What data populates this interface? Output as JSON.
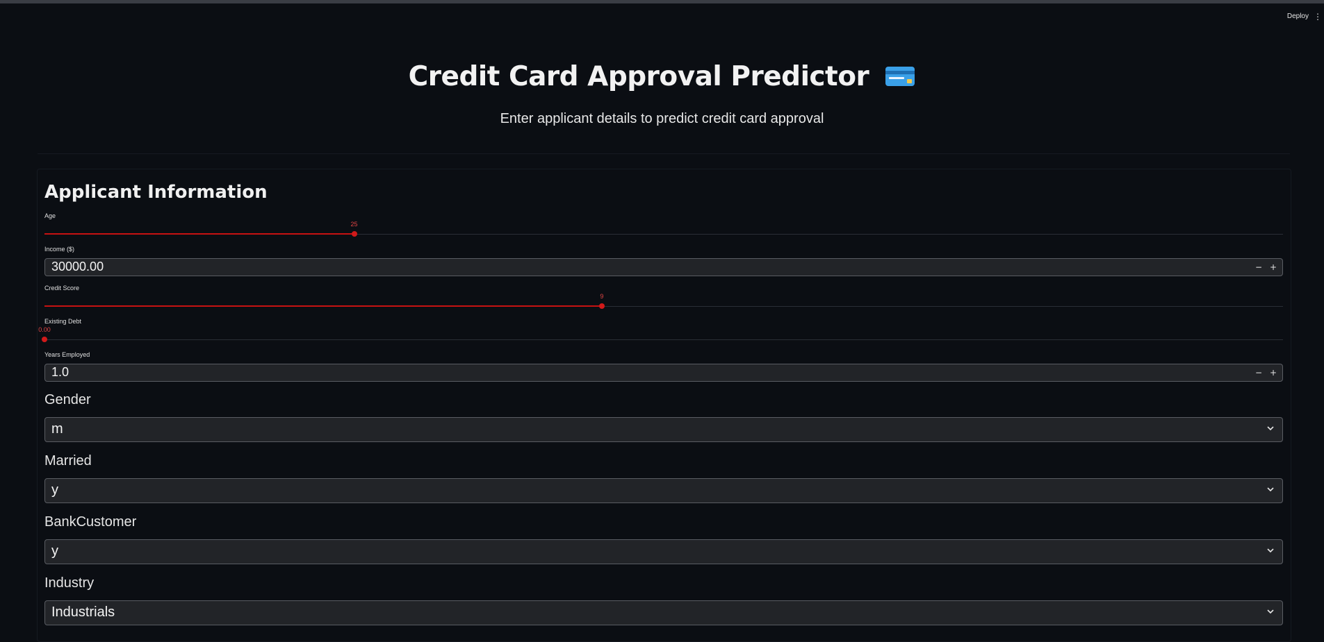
{
  "header": {
    "deploy_label": "Deploy",
    "menu_glyph": "⋮"
  },
  "page": {
    "title": "Credit Card Approval Predictor",
    "subtitle": "Enter applicant details to predict credit card approval"
  },
  "form": {
    "heading": "Applicant Information",
    "age": {
      "label": "Age",
      "value": "25",
      "fraction": 0.25
    },
    "income": {
      "label": "Income ($)",
      "value": "30000.00"
    },
    "credit_score": {
      "label": "Credit Score",
      "value": "9",
      "fraction": 0.45
    },
    "existing_debt": {
      "label": "Existing Debt",
      "value": "0.00",
      "fraction": 0.0
    },
    "years_employed": {
      "label": "Years Employed",
      "value": "1.0"
    },
    "gender": {
      "label": "Gender",
      "value": "m"
    },
    "married": {
      "label": "Married",
      "value": "y"
    },
    "bank_customer": {
      "label": "BankCustomer",
      "value": "y"
    },
    "industry": {
      "label": "Industry",
      "value": "Industrials"
    },
    "stepper": {
      "minus": "−",
      "plus": "+"
    }
  },
  "colors": {
    "background": "#0b0e13",
    "accent": "#c71212",
    "input_bg": "#222428"
  },
  "icons": {
    "card": "credit-card-icon",
    "chevron": "chevron-down-icon"
  }
}
